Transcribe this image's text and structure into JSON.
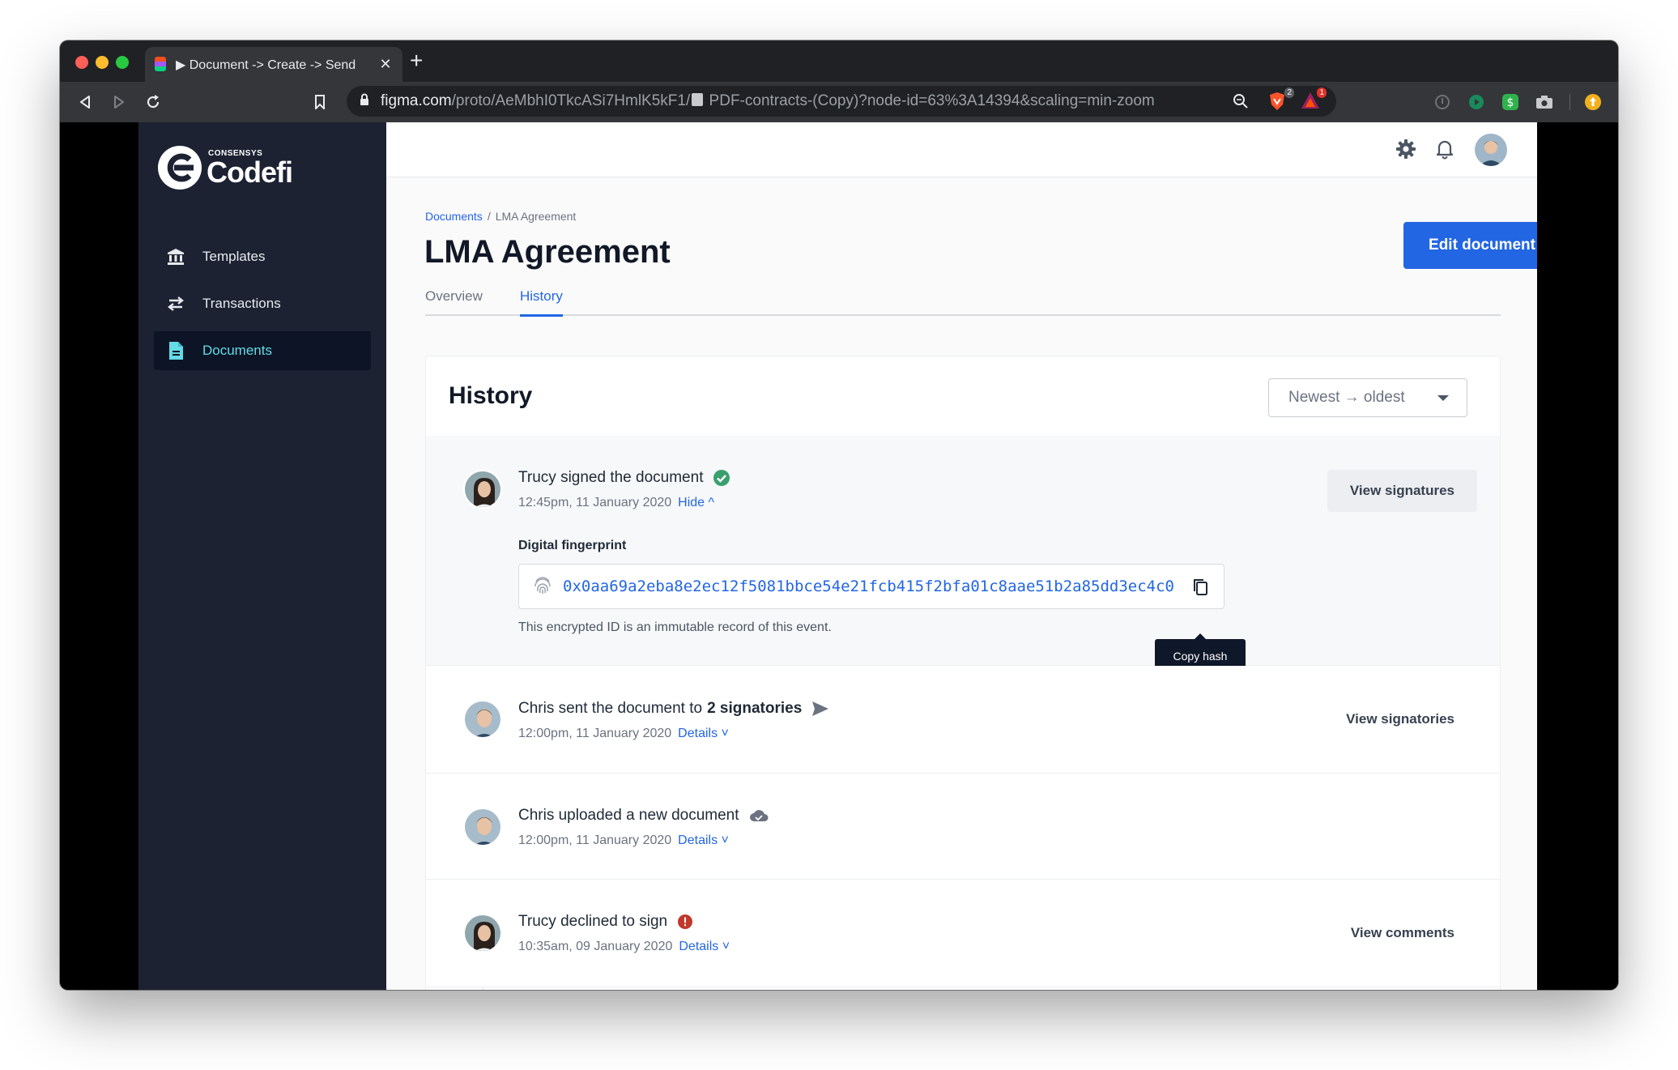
{
  "browser": {
    "tab_title": "▶ Document -> Create -> Send",
    "url_host": "figma.com",
    "url_path": "/proto/AeMbhI0TkcASi7HmlK5kF1/",
    "url_rest": " PDF-contracts-(Copy)?node-id=63%3A14394&scaling=min-zoom",
    "ext_badge_1": "2",
    "ext_badge_2": "1"
  },
  "logo": {
    "small": "CONSENSYS",
    "big": "Codefi"
  },
  "sidebar": {
    "items": [
      {
        "label": "Templates",
        "icon": "bank-icon"
      },
      {
        "label": "Transactions",
        "icon": "swap-arrows-icon"
      },
      {
        "label": "Documents",
        "icon": "document-icon",
        "active": true
      }
    ]
  },
  "breadcrumb": {
    "root": "Documents",
    "separator": "/",
    "current": "LMA Agreement"
  },
  "page": {
    "title": "LMA Agreement",
    "edit_label": "Edit document"
  },
  "tabs": [
    {
      "label": "Overview"
    },
    {
      "label": "History",
      "active": true
    }
  ],
  "history": {
    "title": "History",
    "sort_label": "Newest → oldest",
    "events": [
      {
        "actor": "Trucy",
        "title": "Trucy signed the document",
        "time": "12:45pm, 11 January 2020",
        "toggle": "Hide ^",
        "status_icon": "check-circle-icon",
        "action": "View signatures",
        "fingerprint_label": "Digital fingerprint",
        "fingerprint": "0x0aa69a2eba8e2ec12f5081bbce54e21fcb415f2bfa01c8aae51b2a85dd3ec4c0",
        "fingerprint_note": "This encrypted ID is an immutable record of this event.",
        "tooltip": "Copy hash"
      },
      {
        "actor": "Chris",
        "title_prefix": "Chris sent the document to",
        "title_bold": "2 signatories",
        "time": "12:00pm, 11 January 2020",
        "toggle": "Details ˅",
        "status_icon": "send-icon",
        "action": "View signatories"
      },
      {
        "actor": "Chris",
        "title": "Chris uploaded a new document",
        "time": "12:00pm, 11 January 2020",
        "toggle": "Details ˅",
        "status_icon": "cloud-icon"
      },
      {
        "actor": "Trucy",
        "title": "Trucy declined to sign",
        "time": "10:35am, 09 January 2020",
        "toggle": "Details ˅",
        "status_icon": "alert-circle-icon",
        "action": "View comments"
      }
    ]
  },
  "colors": {
    "primary": "#2266e3",
    "sidebar_bg": "#1c2232",
    "sidebar_active_text": "#64dbe7",
    "success": "#3a9f6e",
    "danger": "#c0392b"
  }
}
